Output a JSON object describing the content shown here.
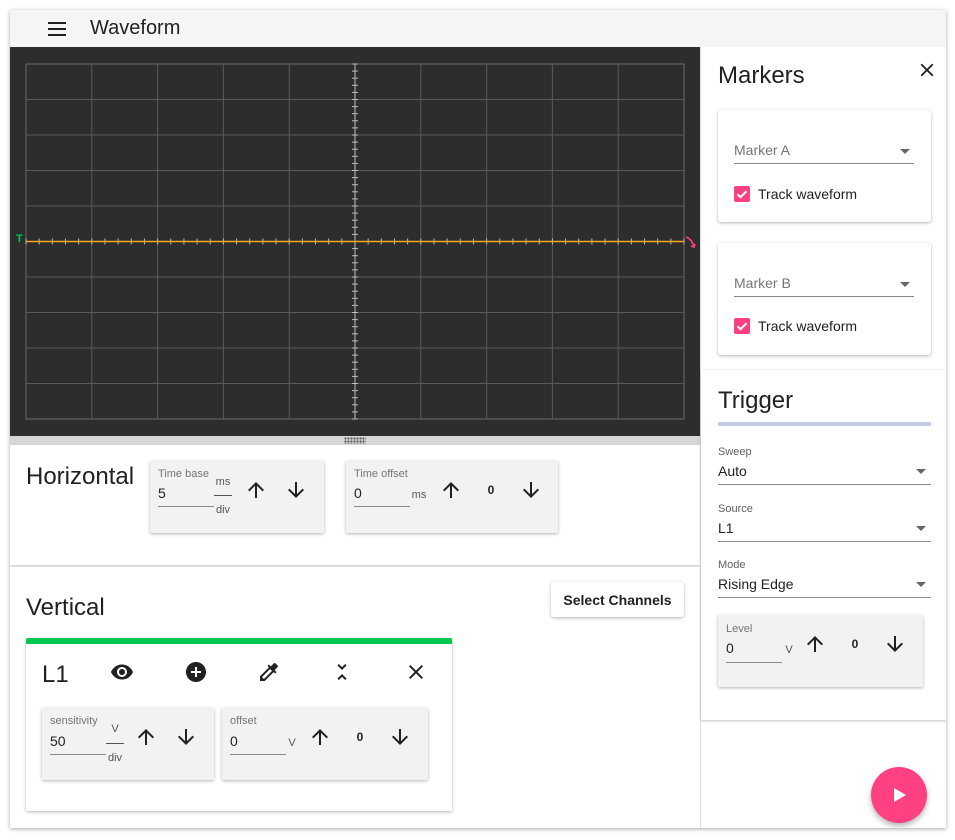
{
  "app": {
    "title": "Waveform"
  },
  "colors": {
    "trace": "#f5a623",
    "trigger_marker": "#00c853",
    "accent": "#ff4081",
    "channel_l1": "#00c853"
  },
  "scope": {
    "trigger_level_label": "T"
  },
  "horizontal": {
    "title": "Horizontal",
    "time_base": {
      "label": "Time base",
      "value": "5",
      "unit_top": "ms",
      "unit_bottom": "div"
    },
    "time_offset": {
      "label": "Time offset",
      "value": "0",
      "unit": "ms",
      "zero_label": "0"
    }
  },
  "vertical": {
    "title": "Vertical",
    "select_channels_label": "Select Channels",
    "channel": {
      "name": "L1",
      "sensitivity": {
        "label": "sensitivity",
        "value": "50",
        "unit_top": "V",
        "unit_bottom": "div"
      },
      "offset": {
        "label": "offset",
        "value": "0",
        "unit": "V",
        "zero_label": "0"
      }
    }
  },
  "markers": {
    "title": "Markers",
    "marker_a": {
      "placeholder": "Marker A",
      "track_label": "Track waveform",
      "track_checked": true
    },
    "marker_b": {
      "placeholder": "Marker B",
      "track_label": "Track waveform",
      "track_checked": true
    }
  },
  "trigger": {
    "title": "Trigger",
    "sweep": {
      "label": "Sweep",
      "value": "Auto"
    },
    "source": {
      "label": "Source",
      "value": "L1"
    },
    "mode": {
      "label": "Mode",
      "value": "Rising Edge"
    },
    "level": {
      "label": "Level",
      "value": "0",
      "unit": "V",
      "zero_label": "0"
    }
  }
}
